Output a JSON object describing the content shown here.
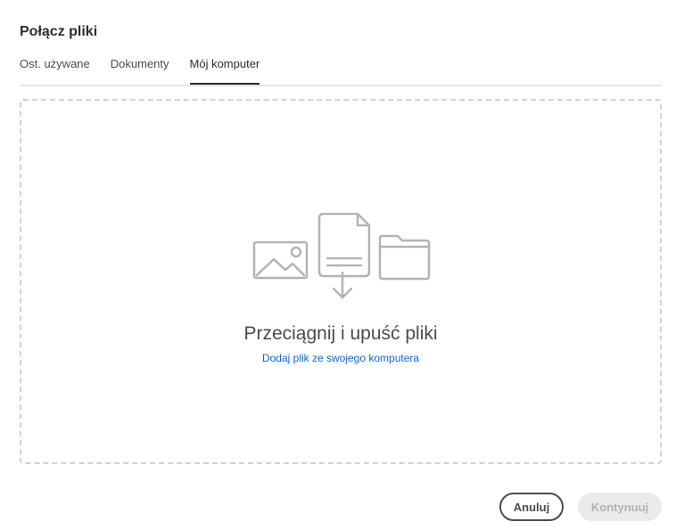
{
  "dialog": {
    "title": "Połącz pliki"
  },
  "tabs": [
    {
      "label": "Ost. używane",
      "active": false
    },
    {
      "label": "Dokumenty",
      "active": false
    },
    {
      "label": "Mój komputer",
      "active": true
    }
  ],
  "dropzone": {
    "title": "Przeciągnij i upuść pliki",
    "link": "Dodaj plik ze swojego komputera",
    "icons": [
      "image-icon",
      "document-download-icon",
      "folder-icon"
    ]
  },
  "footer": {
    "cancel_label": "Anuluj",
    "continue_label": "Kontynuuj",
    "continue_disabled": true
  },
  "colors": {
    "link": "#1473e6",
    "icon_stroke": "#b3b3b3",
    "active_tab_underline": "#2c2c2c"
  }
}
